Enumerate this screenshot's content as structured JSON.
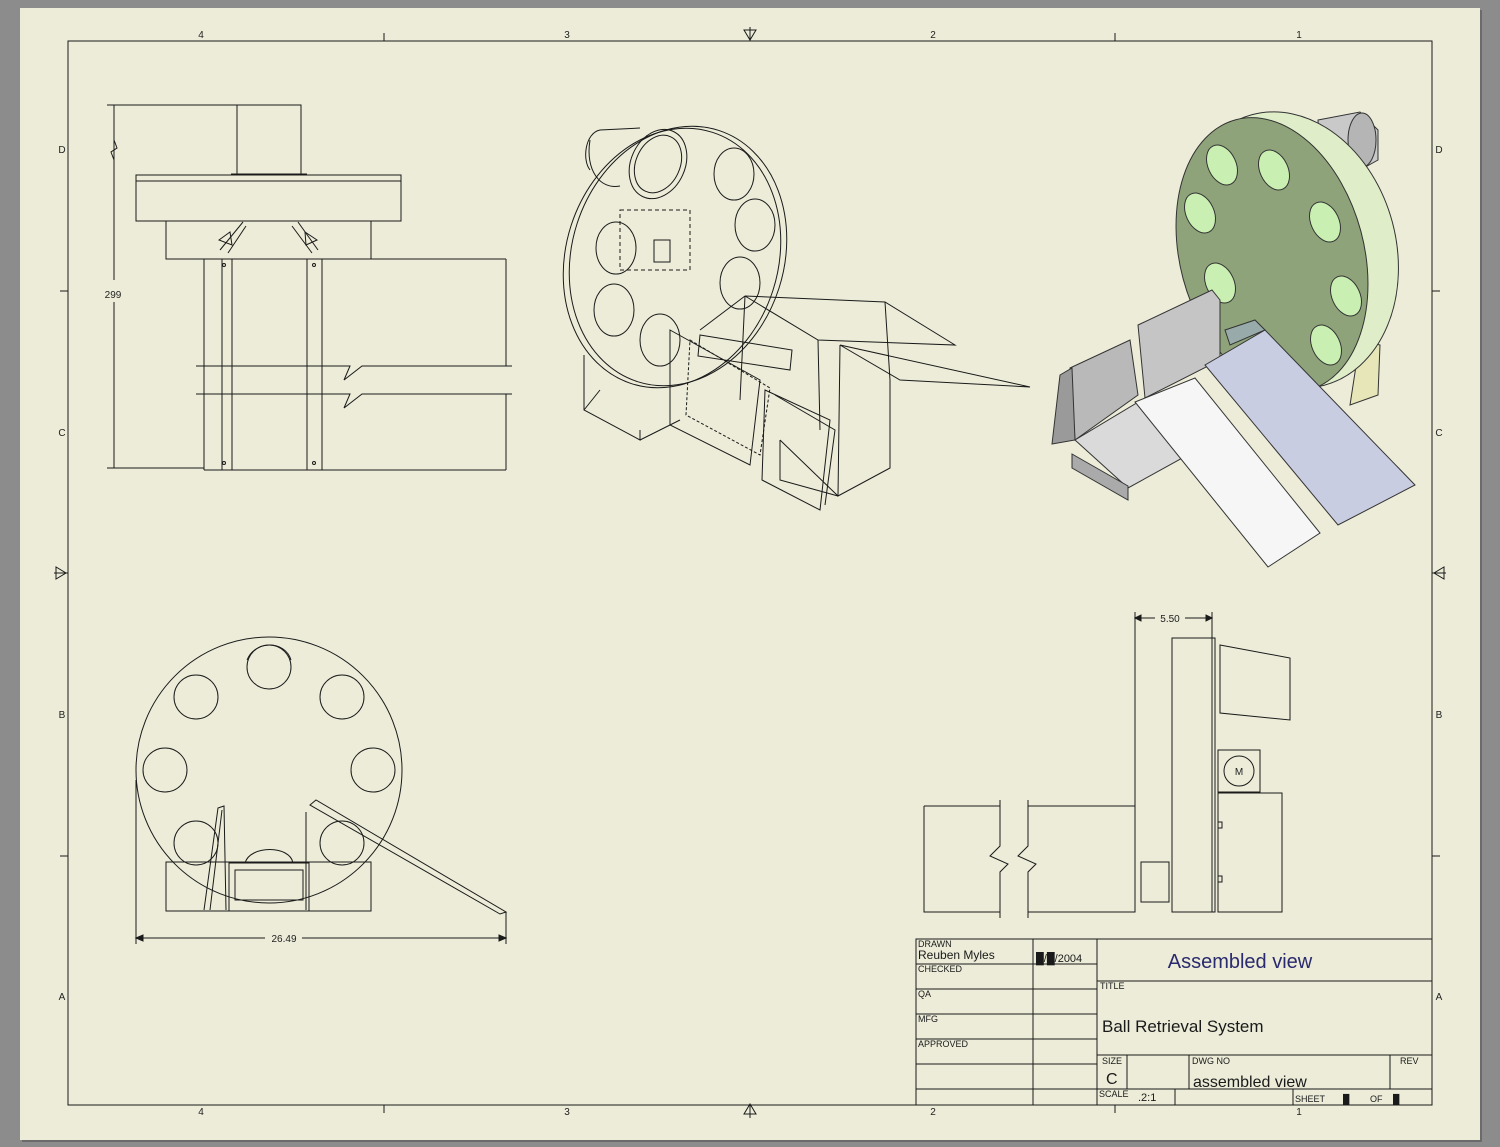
{
  "sheet": {
    "zones_top": [
      "4",
      "3",
      "2",
      "1"
    ],
    "zones_bottom": [
      "4",
      "3",
      "2",
      "1"
    ],
    "rows_left": [
      "D",
      "C",
      "B",
      "A"
    ],
    "rows_right": [
      "D",
      "C",
      "B",
      "A"
    ]
  },
  "dimensions": {
    "front_height": "299",
    "bottom_width": "26.49",
    "side_offset": "5.50",
    "motor_label": "M"
  },
  "title_block": {
    "drawn_label": "DRAWN",
    "drawn_by": "Reuben Myles",
    "drawn_date": "█/█/2004",
    "checked_label": "CHECKED",
    "qa_label": "QA",
    "mfg_label": "MFG",
    "approved_label": "APPROVED",
    "view_title": "Assembled view",
    "title_label": "TITLE",
    "title": "Ball Retrieval System",
    "size_label": "SIZE",
    "size": "C",
    "dwg_no_label": "DWG NO",
    "dwg_no": "assembled view",
    "rev_label": "REV",
    "scale_label": "SCALE",
    "scale": ".2:1",
    "sheet_label": "SHEET",
    "sheet_no": "█",
    "of_label": "OF",
    "sheet_total": "█"
  },
  "colors": {
    "paper": "#ececd9",
    "line": "#1a1a1a",
    "disc_green": "#8fa37a",
    "rim_light": "#dfeec8",
    "chute_gray": "#c5c5c5",
    "ramp_blue": "#c9cde2",
    "title_blue": "#2a2a6e"
  }
}
